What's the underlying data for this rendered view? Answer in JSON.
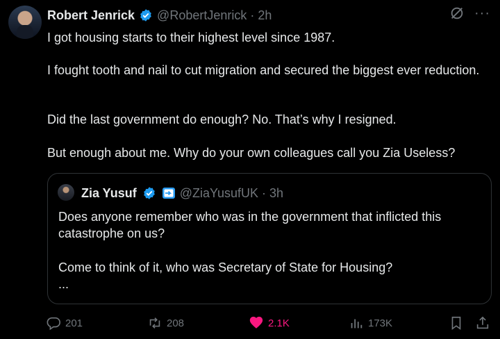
{
  "author": {
    "name": "Robert Jenrick",
    "handle": "@RobertJenrick",
    "time": "2h"
  },
  "separator": "·",
  "more_label": "···",
  "tweet": {
    "paragraphs": [
      "I got housing starts to their highest level since 1987.",
      "I fought tooth and nail to cut migration and secured the biggest ever reduction.",
      "Did the last government do enough? No. That’s why I resigned.",
      "But enough about me. Why do your own colleagues call you Zia Useless?"
    ]
  },
  "quoted": {
    "name": "Zia Yusuf",
    "handle": "@ZiaYusufUK",
    "time": "3h",
    "paragraphs": [
      "Does anyone remember who was in the government that inflicted this catastrophe on us?",
      "Come to think of it, who was Secretary of State for Housing?",
      "..."
    ]
  },
  "actions": {
    "replies": "201",
    "reposts": "208",
    "likes": "2.1K",
    "views": "173K"
  },
  "colors": {
    "background": "#000000",
    "text": "#e7e9ea",
    "secondary": "#71767b",
    "verified": "#1d9bf0",
    "like": "#f91880",
    "border": "#2f3336"
  }
}
